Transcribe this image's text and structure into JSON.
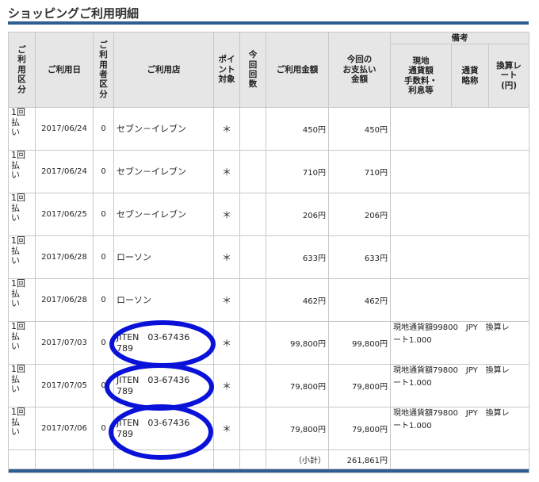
{
  "page": {
    "title": "ショッピングご利用明細"
  },
  "headers": {
    "type": "ご利用区分",
    "date": "ご利用日",
    "user": "ご利用者区分",
    "shop": "ご利用店",
    "point": "ポイント対象",
    "count": "今回回数",
    "amount": "ご利用金額",
    "payment_line1": "今回の",
    "payment_line2": "お支払い",
    "payment_line3": "金額",
    "remarks": "備考",
    "local_line1": "現地",
    "local_line2": "通貨額",
    "local_line3": "手数料・",
    "local_line4": "利息等",
    "currency_line1": "通貨",
    "currency_line2": "略称",
    "rate_line1": "換算レ",
    "rate_line2": "ート",
    "rate_line3": "(円)"
  },
  "rows": [
    {
      "type_line1": "1回",
      "type_line2": "払",
      "type_line3": "い",
      "date": "2017/06/24",
      "user": "0",
      "shop_line1": "セブン－イレブン",
      "shop_line2": "",
      "point": "＊",
      "amount": "450円",
      "payment": "450円",
      "note_line1": "",
      "note_line2": ""
    },
    {
      "type_line1": "1回",
      "type_line2": "払",
      "type_line3": "い",
      "date": "2017/06/24",
      "user": "0",
      "shop_line1": "セブン－イレブン",
      "shop_line2": "",
      "point": "＊",
      "amount": "710円",
      "payment": "710円",
      "note_line1": "",
      "note_line2": ""
    },
    {
      "type_line1": "1回",
      "type_line2": "払",
      "type_line3": "い",
      "date": "2017/06/25",
      "user": "0",
      "shop_line1": "セブン－イレブン",
      "shop_line2": "",
      "point": "＊",
      "amount": "206円",
      "payment": "206円",
      "note_line1": "",
      "note_line2": ""
    },
    {
      "type_line1": "1回",
      "type_line2": "払",
      "type_line3": "い",
      "date": "2017/06/28",
      "user": "0",
      "shop_line1": "ローソン",
      "shop_line2": "",
      "point": "＊",
      "amount": "633円",
      "payment": "633円",
      "note_line1": "",
      "note_line2": ""
    },
    {
      "type_line1": "1回",
      "type_line2": "払",
      "type_line3": "い",
      "date": "2017/06/28",
      "user": "0",
      "shop_line1": "ローソン",
      "shop_line2": "",
      "point": "＊",
      "amount": "462円",
      "payment": "462円",
      "note_line1": "",
      "note_line2": ""
    },
    {
      "type_line1": "1回",
      "type_line2": "払",
      "type_line3": "い",
      "date": "2017/07/03",
      "user": "0",
      "shop_line1": "JITEN　03-67436",
      "shop_line2": "789",
      "point": "＊",
      "amount": "99,800円",
      "payment": "99,800円",
      "note_line1": "現地通貨額99800　JPY　換算レ",
      "note_line2": "ート1.000"
    },
    {
      "type_line1": "1回",
      "type_line2": "払",
      "type_line3": "い",
      "date": "2017/07/05",
      "user": "0",
      "shop_line1": "JITEN　03-67436",
      "shop_line2": "789",
      "point": "＊",
      "amount": "79,800円",
      "payment": "79,800円",
      "note_line1": "現地通貨額79800　JPY　換算レ",
      "note_line2": "ート1.000"
    },
    {
      "type_line1": "1回",
      "type_line2": "払",
      "type_line3": "い",
      "date": "2017/07/06",
      "user": "0",
      "shop_line1": "JITEN　03-67436",
      "shop_line2": "789",
      "point": "＊",
      "amount": "79,800円",
      "payment": "79,800円",
      "note_line1": "現地通貨額79800　JPY　換算レ",
      "note_line2": "ート1.000"
    }
  ],
  "subtotal": {
    "label": "（小計）",
    "value": "261,861円"
  },
  "annotation": {
    "color": "#0a12d8"
  }
}
